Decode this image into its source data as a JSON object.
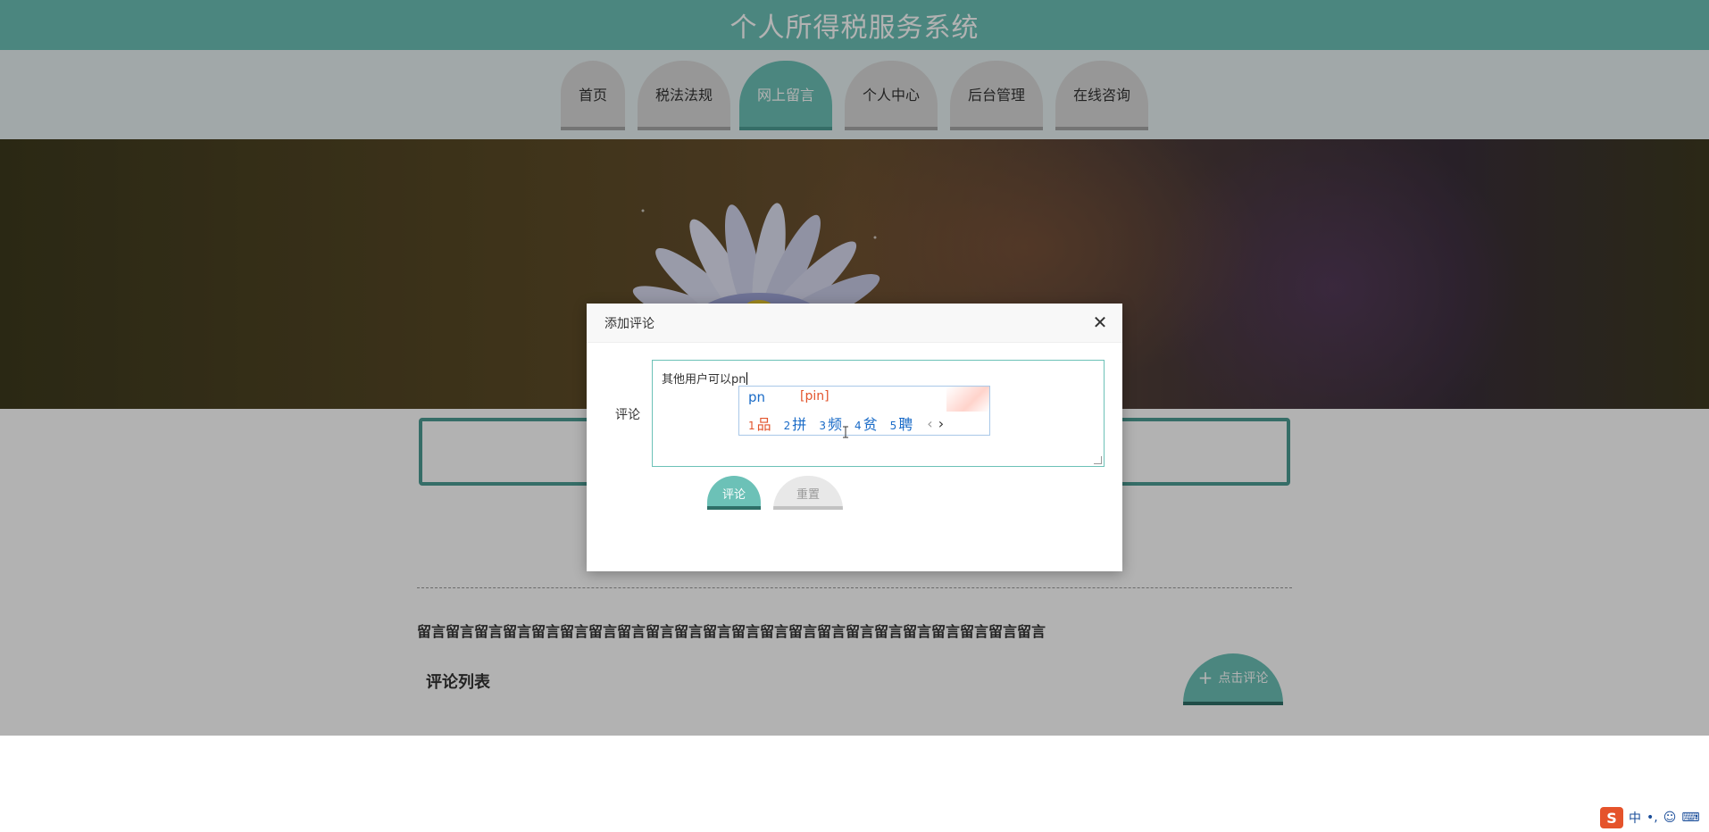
{
  "header": {
    "title": "个人所得税服务系统"
  },
  "nav": {
    "items": [
      {
        "label": "首页",
        "active": false
      },
      {
        "label": "税法法规",
        "active": false
      },
      {
        "label": "网上留言",
        "active": true
      },
      {
        "label": "个人中心",
        "active": false
      },
      {
        "label": "后台管理",
        "active": false
      },
      {
        "label": "在线咨询",
        "active": false
      }
    ]
  },
  "content": {
    "message_text": "留言留言留言留言留言留言留言留言留言留言留言留言留言留言留言留言留言留言留言留言留言留言",
    "comment_list_title": "评论列表",
    "add_comment_label": "点击评论"
  },
  "dialog": {
    "title": "添加评论",
    "close_symbol": "✕",
    "comment_label": "评论",
    "textarea_value": "其他用户可以pn",
    "submit_label": "评论",
    "reset_label": "重置"
  },
  "ime": {
    "input": "pn",
    "pinyin": "[pin]",
    "candidates": [
      {
        "num": "1",
        "text": "品"
      },
      {
        "num": "2",
        "text": "拼"
      },
      {
        "num": "3",
        "text": "频"
      },
      {
        "num": "4",
        "text": "贫"
      },
      {
        "num": "5",
        "text": "聘"
      }
    ],
    "prev_arrow": "‹",
    "next_arrow": "›"
  },
  "taskbar": {
    "ime_logo": "S",
    "ime_mode": "中",
    "punct": "•,",
    "emoji": "☺",
    "keyboard": "⌨"
  },
  "colors": {
    "primary": "#6cc1b7",
    "primary_dark": "#4c9d94",
    "ime_blue": "#1a6bc7",
    "ime_red": "#e2542c"
  }
}
